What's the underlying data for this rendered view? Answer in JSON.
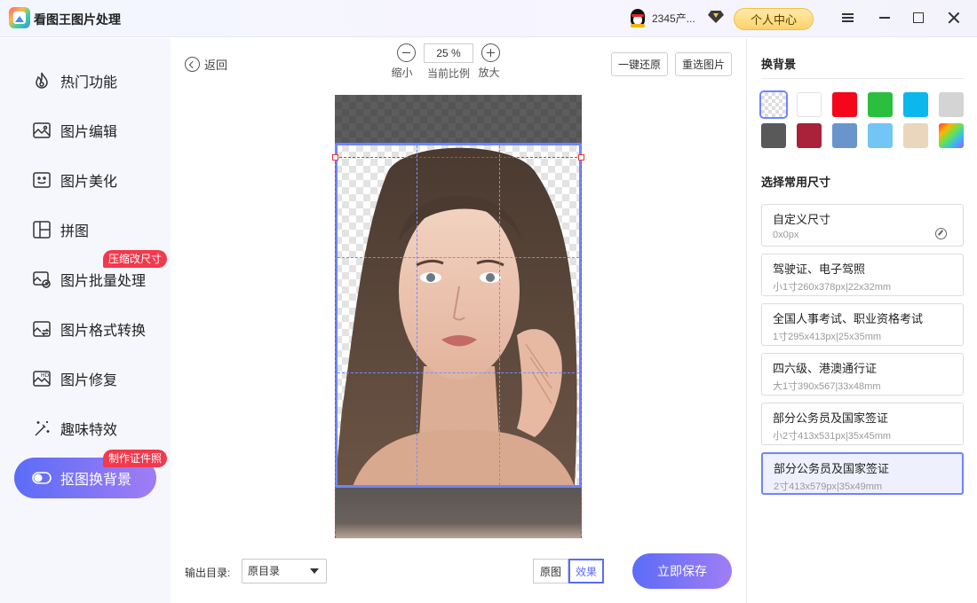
{
  "app": {
    "title": "看图王图片处理"
  },
  "header": {
    "user_name": "2345产...",
    "personal_center": "个人中心"
  },
  "sidebar": {
    "items": [
      {
        "label": "热门功能",
        "icon": "flame-icon"
      },
      {
        "label": "图片编辑",
        "icon": "image-edit-icon"
      },
      {
        "label": "图片美化",
        "icon": "image-beautify-icon"
      },
      {
        "label": "拼图",
        "icon": "collage-icon"
      },
      {
        "label": "图片批量处理",
        "icon": "batch-image-icon",
        "badge": "压缩改尺寸"
      },
      {
        "label": "图片格式转换",
        "icon": "format-convert-icon"
      },
      {
        "label": "图片修复",
        "icon": "hd-repair-icon"
      },
      {
        "label": "趣味特效",
        "icon": "magic-wand-icon"
      },
      {
        "label": "抠图换背景",
        "icon": "toggle-icon",
        "badge": "制作证件照",
        "active": true
      }
    ]
  },
  "toolbar": {
    "back": "返回",
    "zoom_out": "缩小",
    "zoom_value": "25 %",
    "zoom_current": "当前比例",
    "zoom_in": "放大",
    "restore": "一键还原",
    "reselect": "重选图片"
  },
  "bottom": {
    "output_label": "输出目录:",
    "output_value": "原目录",
    "original": "原图",
    "effect": "效果",
    "save": "立即保存"
  },
  "right_panel": {
    "bg_title": "换背景",
    "colors": [
      "transparent",
      "#ffffff",
      "#f5071b",
      "#2bbf3f",
      "#0cb7ee",
      "#d4d4d4",
      "#595959",
      "#a9223a",
      "#6a95cc",
      "#72c6f6",
      "#ead6bc",
      "rainbow"
    ],
    "size_title": "选择常用尺寸",
    "sizes": [
      {
        "name": "自定义尺寸",
        "sub": "0x0px"
      },
      {
        "name": "驾驶证、电子驾照",
        "sub": "小1寸260x378px|22x32mm"
      },
      {
        "name": "全国人事考试、职业资格考试",
        "sub": "1寸295x413px|25x35mm"
      },
      {
        "name": "四六级、港澳通行证",
        "sub": "大1寸390x567|33x48mm"
      },
      {
        "name": "部分公务员及国家签证",
        "sub": "小2寸413x531px|35x45mm"
      },
      {
        "name": "部分公务员及国家签证",
        "sub": "2寸413x579px|35x49mm",
        "selected": true
      }
    ]
  }
}
